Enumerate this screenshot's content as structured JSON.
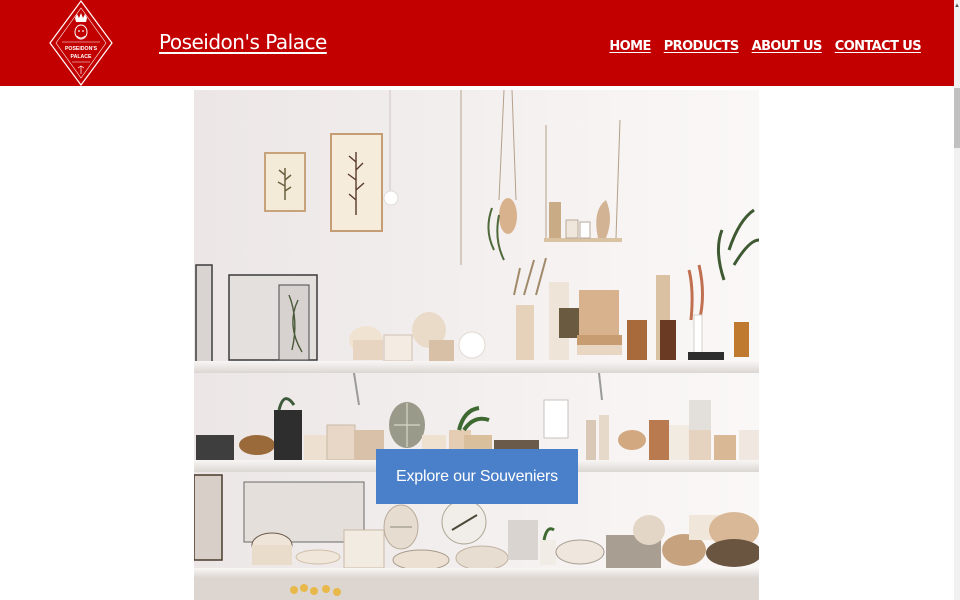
{
  "header": {
    "logo": {
      "icon": "trident-shield-icon",
      "text_line1": "POSEIDON'S",
      "text_line2": "PALACE"
    },
    "site_title": "Poseidon's Palace",
    "nav": [
      "HOME",
      "PRODUCTS",
      "ABOUT US",
      "CONTACT US"
    ]
  },
  "hero": {
    "image": "gift-shop-shelves-photo",
    "button_label": "Explore our Souveniers"
  },
  "colors": {
    "header_bg": "#c20000",
    "button_bg": "#4a7fc9",
    "text_on_dark": "#ffffff"
  }
}
